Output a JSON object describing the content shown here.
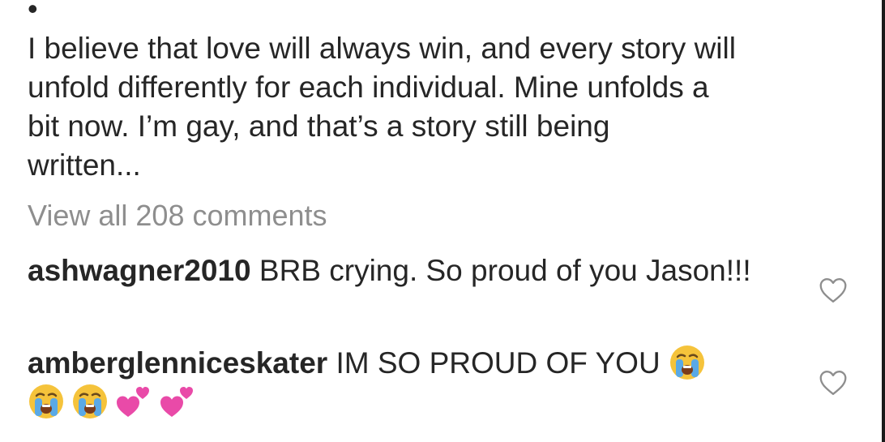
{
  "caption": {
    "text": "I believe that love will always win, and every story will\nunfold differently for each individual. Mine unfolds a\nbit now. I’m gay, and that’s a story still being\nwritten..."
  },
  "view_all": {
    "label": "View all 208 comments"
  },
  "comments": [
    {
      "username": "ashwagner2010",
      "text": "BRB crying. So proud of you Jason!!!"
    },
    {
      "username": "amberglenniceskater",
      "text": "IM SO PROUD OF YOU",
      "emojis": [
        "loudly-crying-face",
        "loudly-crying-face",
        "loudly-crying-face",
        "two-hearts",
        "two-hearts"
      ]
    }
  ],
  "colors": {
    "text": "#262626",
    "muted": "#8e8e8e",
    "heart_outline": "#8e8e8e"
  },
  "icons": {
    "like": "heart-outline-icon"
  }
}
